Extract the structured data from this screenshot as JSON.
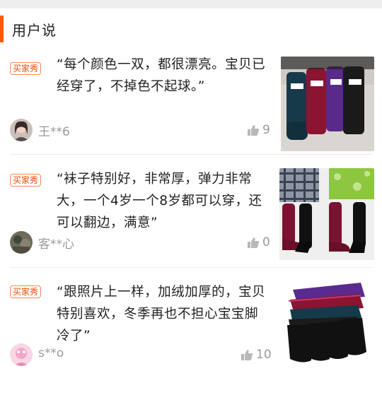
{
  "section": {
    "title": "用户说"
  },
  "reviews": [
    {
      "badge": "买家秀",
      "content": "“每个颜色一双，都很漂亮。宝贝已经穿了，不掉色不起球。”",
      "username": "王**6",
      "likes": "9",
      "avatar_icon": "avatar-girl-photo",
      "thumbnail_icon": "colored-socks-photo"
    },
    {
      "badge": "买家秀",
      "content": "“袜子特别好，非常厚，弹力非常大，一个4岁一个8岁都可以穿，还可以翻边，满意”",
      "username": "客**心",
      "likes": "0",
      "avatar_icon": "avatar-photo",
      "thumbnail_icon": "kids-wearing-socks-photo"
    },
    {
      "badge": "买家秀",
      "content": "“跟照片上一样，加绒加厚的，宝贝特别喜欢，冬季再也不担心宝宝脚冷了”",
      "username": "s**o",
      "likes": "10",
      "avatar_icon": "avatar-pink-photo",
      "thumbnail_icon": "stacked-socks-photo"
    }
  ],
  "colors": {
    "accent": "#ff5a00",
    "badge": "#f04a00",
    "muted": "#9a9a9a"
  }
}
